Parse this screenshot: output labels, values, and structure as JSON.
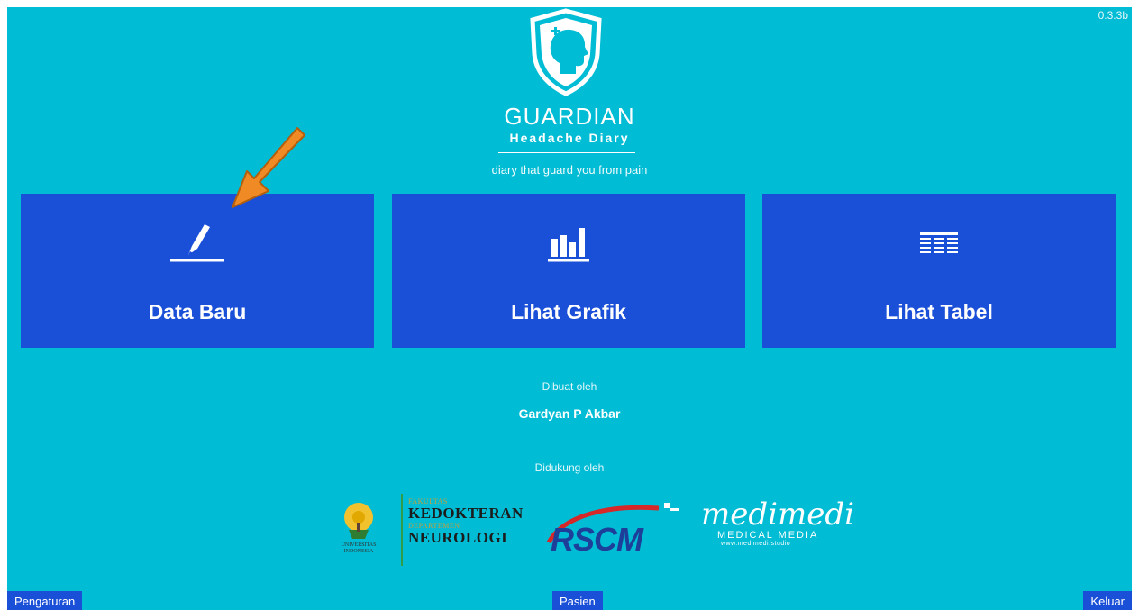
{
  "app": {
    "version": "0.3.3b",
    "name": "GUARDIAN",
    "subtitle": "Headache Diary",
    "tagline": "diary that guard you from pain"
  },
  "tiles": [
    {
      "label": "Data Baru",
      "icon": "pencil-icon"
    },
    {
      "label": "Lihat Grafik",
      "icon": "bar-chart-icon"
    },
    {
      "label": "Lihat Tabel",
      "icon": "table-icon"
    }
  ],
  "credits": {
    "made_by_label": "Dibuat oleh",
    "author": "Gardyan P Akbar",
    "supported_by_label": "Didukung oleh"
  },
  "sponsors": {
    "ui_seal_text": "UNIVERSITAS INDONESIA",
    "fk_small_1": "FAKULTAS",
    "fk_big_1": "KEDOKTERAN",
    "fk_small_2": "DEPARTEMEN",
    "fk_big_2": "NEUROLOGI",
    "rscm": "RSCM",
    "medimedi": "medimedi",
    "medimedi_sub": "MEDICAL MEDIA",
    "medimedi_url": "www.medimedi.studio"
  },
  "footer": {
    "settings": "Pengaturan",
    "patient": "Pasien",
    "exit": "Keluar"
  },
  "colors": {
    "background": "#00bcd4",
    "tile": "#1a4fd8",
    "arrow": "#f08a24"
  }
}
